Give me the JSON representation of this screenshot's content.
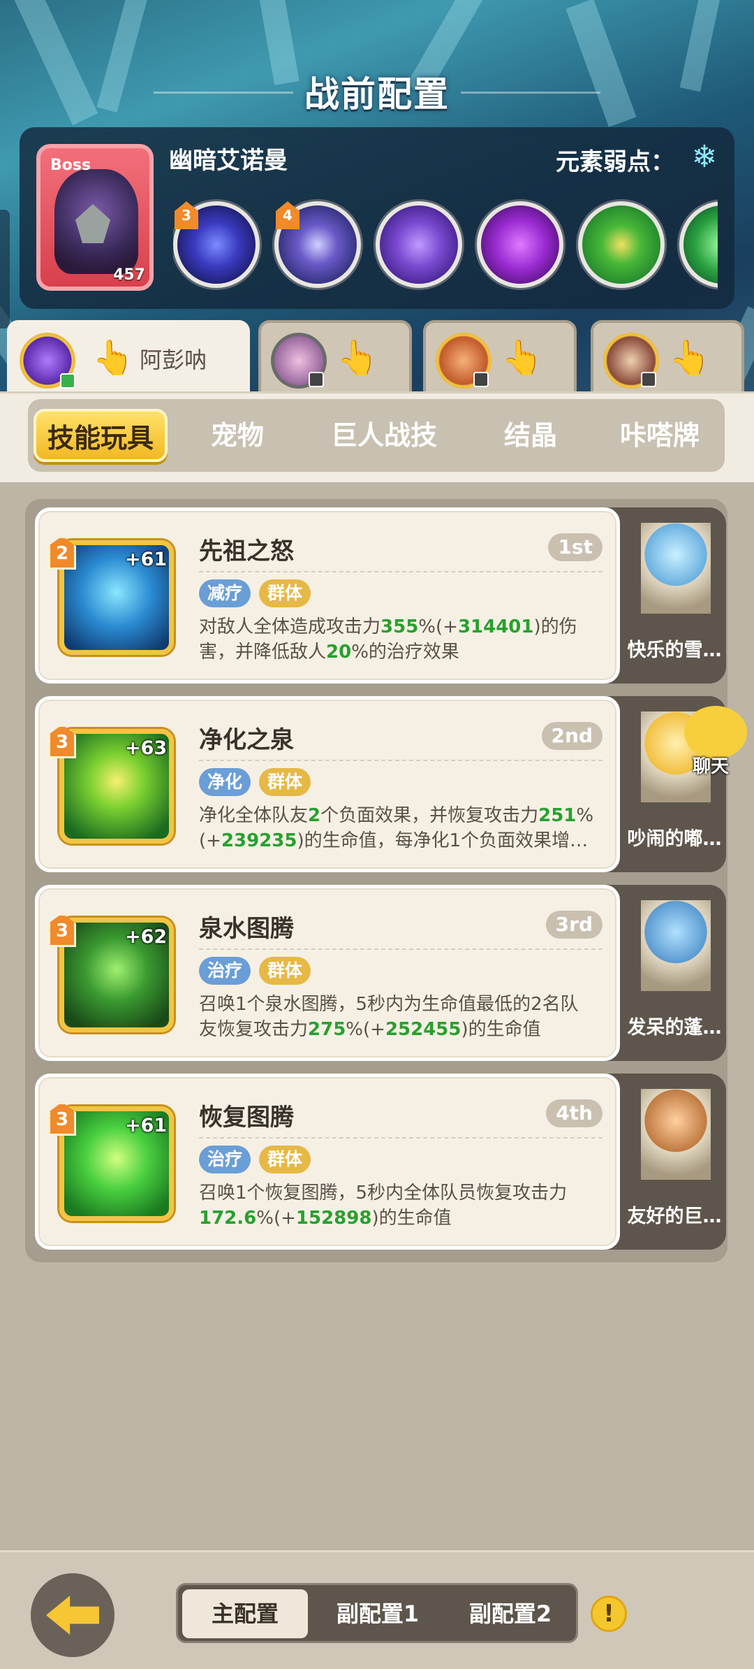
{
  "header": {
    "title": "战前配置"
  },
  "boss": {
    "tag": "Boss",
    "level": "457",
    "name": "幽暗艾诺曼",
    "weakness_label": "元素弱点：",
    "weakness_icon": "snowflake-icon",
    "skills": [
      {
        "icon": "dark-burst-icon",
        "badge": "3"
      },
      {
        "icon": "dark-crest-icon",
        "badge": "4"
      },
      {
        "icon": "dark-drop-icon",
        "badge": ""
      },
      {
        "icon": "poison-cloud-icon",
        "badge": ""
      },
      {
        "icon": "hourglass-icon",
        "badge": ""
      },
      {
        "icon": "partial-skill-icon",
        "badge": ""
      }
    ]
  },
  "characters": [
    {
      "name": "阿彭呐",
      "active": true
    },
    {
      "name": "",
      "active": false
    },
    {
      "name": "",
      "active": false
    },
    {
      "name": "",
      "active": false
    }
  ],
  "categories": [
    "技能玩具",
    "宠物",
    "巨人战技",
    "结晶",
    "咔嗒牌"
  ],
  "cards": [
    {
      "name": "先祖之怒",
      "rank": "1st",
      "level": "2",
      "plus": "+61",
      "tags": [
        "减疗",
        "群体"
      ],
      "desc_parts": [
        "对敌人全体造成攻击力",
        "355",
        "%(+",
        "314401",
        ")的伤害，并降低敌人",
        "20",
        "%的治疗效果"
      ],
      "pet": "快乐的雪…"
    },
    {
      "name": "净化之泉",
      "rank": "2nd",
      "level": "3",
      "plus": "+63",
      "tags": [
        "净化",
        "群体"
      ],
      "desc_parts": [
        "净化全体队友",
        "2",
        "个负面效果，并恢复攻击力",
        "251",
        "%(+",
        "239235",
        ")的生命值，每净化1个负面效果增…"
      ],
      "pet": "吵闹的嘟…"
    },
    {
      "name": "泉水图腾",
      "rank": "3rd",
      "level": "3",
      "plus": "+62",
      "tags": [
        "治疗",
        "群体"
      ],
      "desc_parts": [
        "召唤1个泉水图腾，5秒内为生命值最低的2名队友恢复攻击力",
        "275",
        "%(+",
        "252455",
        ")的生命值"
      ],
      "pet": "发呆的蓬…"
    },
    {
      "name": "恢复图腾",
      "rank": "4th",
      "level": "3",
      "plus": "+61",
      "tags": [
        "治疗",
        "群体"
      ],
      "desc_parts": [
        "召唤1个恢复图腾，5秒内全体队员恢复攻击力",
        "172.6",
        "%(+",
        "152898",
        ")的生命值"
      ],
      "pet": "友好的巨…"
    }
  ],
  "chat": {
    "label": "聊天"
  },
  "configs": [
    "主配置",
    "副配置1",
    "副配置2"
  ],
  "warning": "!"
}
